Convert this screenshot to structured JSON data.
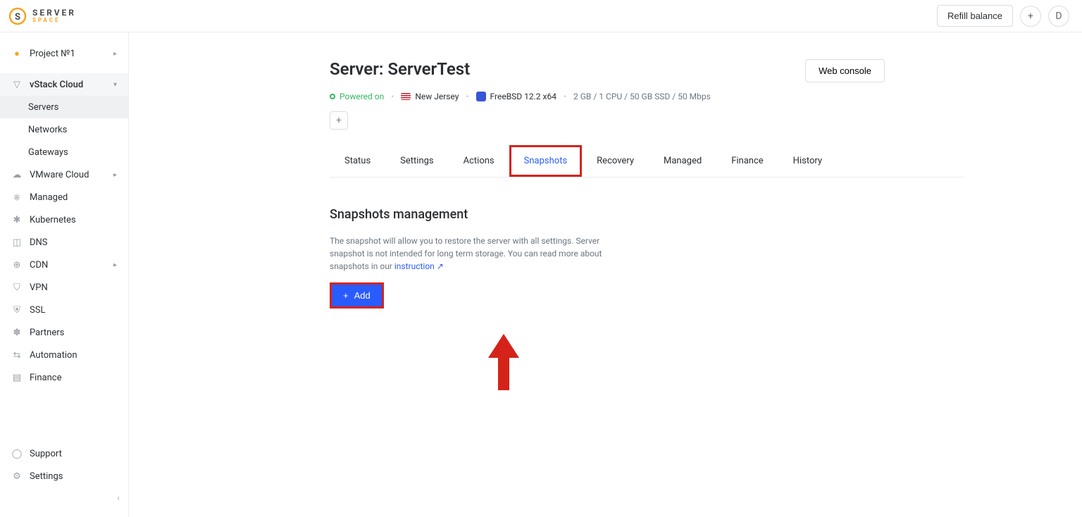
{
  "header": {
    "logo_top": "SERVER",
    "logo_bottom": "SPACE",
    "refill": "Refill balance",
    "avatar_initial": "D"
  },
  "sidebar": {
    "project": "Project №1",
    "vstack": "vStack Cloud",
    "vstack_items": [
      "Servers",
      "Networks",
      "Gateways"
    ],
    "items": [
      {
        "label": "VMware Cloud",
        "icon": "☁",
        "chev": true
      },
      {
        "label": "Managed",
        "icon": "⎈"
      },
      {
        "label": "Kubernetes",
        "icon": "✱"
      },
      {
        "label": "DNS",
        "icon": "◫"
      },
      {
        "label": "CDN",
        "icon": "⊕",
        "chev": true
      },
      {
        "label": "VPN",
        "icon": "⛉"
      },
      {
        "label": "SSL",
        "icon": "⛨"
      },
      {
        "label": "Partners",
        "icon": "✽"
      },
      {
        "label": "Automation",
        "icon": "⇆"
      },
      {
        "label": "Finance",
        "icon": "▤"
      }
    ],
    "bottom": [
      {
        "label": "Support",
        "icon": "◯"
      },
      {
        "label": "Settings",
        "icon": "⚙"
      }
    ]
  },
  "page": {
    "title": "Server: ServerTest",
    "web_console": "Web console",
    "power": "Powered on",
    "location": "New Jersey",
    "os": "FreeBSD 12.2 x64",
    "specs": "2 GB / 1 CPU / 50 GB SSD / 50 Mbps"
  },
  "tabs": [
    "Status",
    "Settings",
    "Actions",
    "Snapshots",
    "Recovery",
    "Managed",
    "Finance",
    "History"
  ],
  "snapshots": {
    "heading": "Snapshots management",
    "desc": "The snapshot will allow you to restore the server with all settings. Server snapshot is not intended for long term storage. You can read more about snapshots in our ",
    "link": "instruction",
    "add": "Add"
  }
}
